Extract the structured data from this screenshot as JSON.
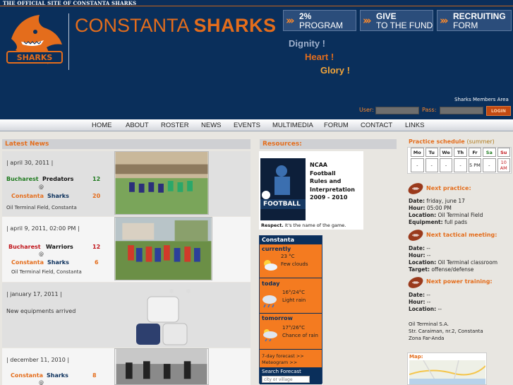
{
  "site": {
    "tagline": "THE OFFICIAL SITE OF CONSTANTA SHARKS",
    "brand_left": "CONSTANTA",
    "brand_right": "SHARKS",
    "logo_text": "SHARKS"
  },
  "promos": [
    {
      "l1": "2%",
      "l2": "PROGRAM"
    },
    {
      "l1": "GIVE",
      "l2": "TO THE FUND"
    },
    {
      "l1": "RECRUITING",
      "l2": "FORM"
    }
  ],
  "motto": {
    "a": "Dignity !",
    "b": "Heart !",
    "c": "Glory !"
  },
  "login": {
    "members_area": "Sharks Members Area",
    "user_label": "User:",
    "pass_label": "Pass:",
    "button": "LOGIN"
  },
  "nav": [
    "HOME",
    "ABOUT",
    "ROSTER",
    "NEWS",
    "EVENTS",
    "MULTIMEDIA",
    "FORUM",
    "CONTACT",
    "LINKS"
  ],
  "latest_news": {
    "title": "Latest News",
    "items": [
      {
        "date": "| april 30, 2011 |",
        "home_a": "Bucharest",
        "home_b": "Predators",
        "home_score": "12",
        "at": "@",
        "away_a": "Constanta",
        "away_b": "Sharks",
        "away_score": "20",
        "venue": "Oil Terminal Field, Constanta"
      },
      {
        "date": "| april 9, 2011, 02:00 PM |",
        "home_a": "Bucharest",
        "home_b": "Warriors",
        "home_score": "12",
        "at": "@",
        "away_a": "Constanta",
        "away_b": "Sharks",
        "away_score": "6",
        "venue": "Oil Terminal Field, Constanta"
      },
      {
        "date": "| january 17, 2011 |",
        "text": "New equipments arrived"
      },
      {
        "date": "| december 11, 2010 |",
        "home_a": "Constanta",
        "home_b": "Sharks",
        "home_score": "8",
        "at": "@"
      }
    ]
  },
  "resources": {
    "title": "Resources:",
    "book_title_1": "NCAA",
    "book_title_2": "Football",
    "book_title_3": "Rules and",
    "book_title_4": "Interpretation",
    "book_title_5": "2009 - 2010",
    "cover_text": "FOOTBALL",
    "caption_bold": "Respect.",
    "caption_rest": " It's the name of the game."
  },
  "weather": {
    "city": "Constanta",
    "currently_label": "currently",
    "currently_temp": "23 °C",
    "currently_desc": "Few clouds",
    "today_label": "today",
    "today_temp": "16°/24°C",
    "today_desc": "Light rain",
    "tomorrow_label": "tomorrow",
    "tomorrow_temp": "17°/26°C",
    "tomorrow_desc": "Chance of rain",
    "link1": "7-day forecast >>",
    "link2": "Meteogram >>",
    "search_label": "Search Forecast",
    "search_placeholder": "city or village"
  },
  "schedule": {
    "title": "Practice schedule",
    "season": "(summer)",
    "days": [
      "Mo",
      "Tu",
      "We",
      "Th",
      "Fr",
      "Sa",
      "Su"
    ],
    "cells": [
      "-",
      "-",
      "-",
      "-",
      "5 PM",
      "-",
      "10 AM"
    ]
  },
  "next_practice": {
    "title": "Next practice:",
    "date_label": "Date:",
    "date": "friday, june 17",
    "hour_label": "Hour:",
    "hour": "05:00 PM",
    "location_label": "Location:",
    "location": "Oil Terminal Field",
    "equipment_label": "Equipment:",
    "equipment": "full pads"
  },
  "next_tactical": {
    "title": "Next tactical meeting:",
    "date_label": "Date:",
    "date": "--",
    "hour_label": "Hour:",
    "hour": "--",
    "location_label": "Location:",
    "location": "Oil Terminal classroom",
    "target_label": "Target:",
    "target": "offense/defense"
  },
  "next_power": {
    "title": "Next power training:",
    "date_label": "Date:",
    "date": "--",
    "hour_label": "Hour:",
    "hour": "--",
    "location_label": "Location:",
    "location": "--"
  },
  "address": {
    "l1": "Oil Terminal S.A.",
    "l2": "Str. Caraiman, nr.2, Constanta",
    "l3": "Zona Far-Anda"
  },
  "map": {
    "title": "Map:"
  },
  "colors": {
    "navy": "#0a2f5b",
    "orange": "#e46d1c",
    "home_team": "#1e7a1e",
    "bucharest_red": "#c0151b"
  }
}
